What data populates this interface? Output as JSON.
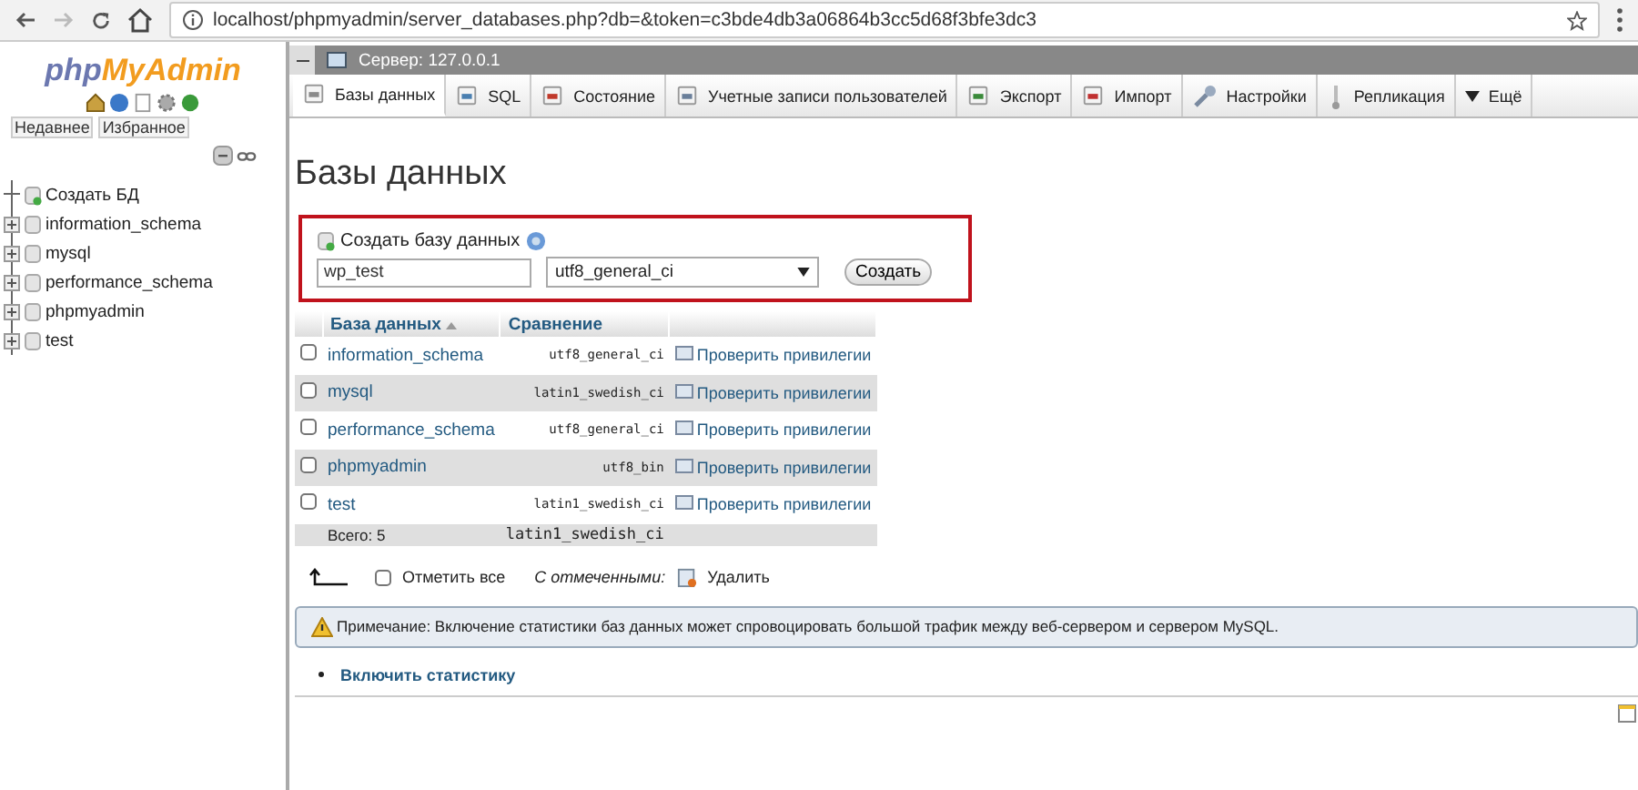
{
  "browser": {
    "url": "localhost/phpmyadmin/server_databases.php?db=&token=c3bde4db3a06864b3cc5d68f3bfe3dc3"
  },
  "sidebar": {
    "logo_left": "php",
    "logo_right": "MyAdmin",
    "tabs": [
      {
        "label": "Недавнее"
      },
      {
        "label": "Избранное"
      }
    ],
    "tree": [
      {
        "label": "Создать БД",
        "kind": "new"
      },
      {
        "label": "information_schema",
        "kind": "db"
      },
      {
        "label": "mysql",
        "kind": "db"
      },
      {
        "label": "performance_schema",
        "kind": "db"
      },
      {
        "label": "phpmyadmin",
        "kind": "db"
      },
      {
        "label": "test",
        "kind": "db"
      }
    ]
  },
  "server_bar": {
    "title": "Сервер: 127.0.0.1"
  },
  "tabs": [
    {
      "label": "Базы данных",
      "selected": true
    },
    {
      "label": "SQL",
      "selected": false
    },
    {
      "label": "Состояние",
      "selected": false
    },
    {
      "label": "Учетные записи пользователей",
      "selected": false
    },
    {
      "label": "Экспорт",
      "selected": false
    },
    {
      "label": "Импорт",
      "selected": false
    },
    {
      "label": "Настройки",
      "selected": false
    },
    {
      "label": "Репликация",
      "selected": false
    },
    {
      "label": "Ещё",
      "selected": false
    }
  ],
  "heading": "Базы данных",
  "create": {
    "title": "Создать базу данных",
    "name_value": "wp_test",
    "collation_value": "utf8_general_ci",
    "button": "Создать"
  },
  "table": {
    "columns": [
      "База данных",
      "Сравнение"
    ],
    "rows": [
      {
        "name": "information_schema",
        "collation": "utf8_general_ci",
        "action": "Проверить привилегии",
        "checked": false
      },
      {
        "name": "mysql",
        "collation": "latin1_swedish_ci",
        "action": "Проверить привилегии",
        "checked": false
      },
      {
        "name": "performance_schema",
        "collation": "utf8_general_ci",
        "action": "Проверить привилегии",
        "checked": false
      },
      {
        "name": "phpmyadmin",
        "collation": "utf8_bin",
        "action": "Проверить привилегии",
        "checked": false
      },
      {
        "name": "test",
        "collation": "latin1_swedish_ci",
        "action": "Проверить привилегии",
        "checked": false
      }
    ],
    "total": {
      "label": "Всего: 5",
      "collation": "latin1_swedish_ci"
    }
  },
  "bulk": {
    "check_all": "Отметить все",
    "checked": false,
    "with_selected": "С отмеченными:",
    "delete": "Удалить"
  },
  "notice": "Примечание: Включение статистики баз данных может спровоцировать большой трафик между веб-сервером и сервером MySQL.",
  "enable_stats": "Включить статистику"
}
